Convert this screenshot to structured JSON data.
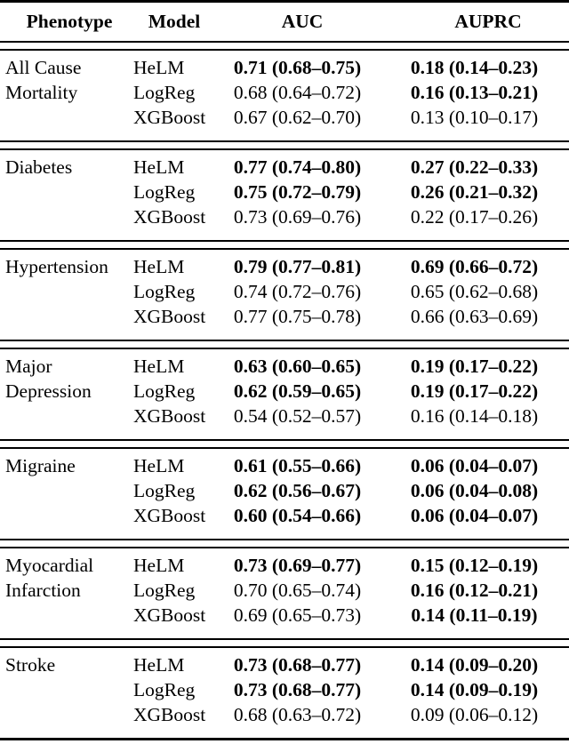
{
  "table": {
    "columns": [
      "Phenotype",
      "Model",
      "AUC",
      "AUPRC"
    ],
    "headers": {
      "phenotype": "Phenotype",
      "model": "Model",
      "auc": "AUC",
      "auprc": "AUPRC"
    },
    "blocks": [
      {
        "phenotype": "All Cause Mortality",
        "phenotype_line1": "All Cause",
        "phenotype_line2": "Mortality",
        "rows": [
          {
            "model": "HeLM",
            "auc": "0.71 (0.68–0.75)",
            "auc_bold": true,
            "auprc": "0.18 (0.14–0.23)",
            "auprc_bold": true
          },
          {
            "model": "LogReg",
            "auc": "0.68 (0.64–0.72)",
            "auc_bold": false,
            "auprc": "0.16 (0.13–0.21)",
            "auprc_bold": true
          },
          {
            "model": "XGBoost",
            "auc": "0.67 (0.62–0.70)",
            "auc_bold": false,
            "auprc": "0.13 (0.10–0.17)",
            "auprc_bold": false
          }
        ]
      },
      {
        "phenotype": "Diabetes",
        "phenotype_line1": "Diabetes",
        "phenotype_line2": "",
        "rows": [
          {
            "model": "HeLM",
            "auc": "0.77 (0.74–0.80)",
            "auc_bold": true,
            "auprc": "0.27 (0.22–0.33)",
            "auprc_bold": true
          },
          {
            "model": "LogReg",
            "auc": "0.75 (0.72–0.79)",
            "auc_bold": true,
            "auprc": "0.26 (0.21–0.32)",
            "auprc_bold": true
          },
          {
            "model": "XGBoost",
            "auc": "0.73 (0.69–0.76)",
            "auc_bold": false,
            "auprc": "0.22 (0.17–0.26)",
            "auprc_bold": false
          }
        ]
      },
      {
        "phenotype": "Hypertension",
        "phenotype_line1": "Hypertension",
        "phenotype_line2": "",
        "rows": [
          {
            "model": "HeLM",
            "auc": "0.79 (0.77–0.81)",
            "auc_bold": true,
            "auprc": "0.69 (0.66–0.72)",
            "auprc_bold": true
          },
          {
            "model": "LogReg",
            "auc": "0.74 (0.72–0.76)",
            "auc_bold": false,
            "auprc": "0.65 (0.62–0.68)",
            "auprc_bold": false
          },
          {
            "model": "XGBoost",
            "auc": "0.77 (0.75–0.78)",
            "auc_bold": false,
            "auprc": "0.66 (0.63–0.69)",
            "auprc_bold": false
          }
        ]
      },
      {
        "phenotype": "Major Depression",
        "phenotype_line1": "Major",
        "phenotype_line2": "Depression",
        "rows": [
          {
            "model": "HeLM",
            "auc": "0.63 (0.60–0.65)",
            "auc_bold": true,
            "auprc": "0.19 (0.17–0.22)",
            "auprc_bold": true
          },
          {
            "model": "LogReg",
            "auc": "0.62 (0.59–0.65)",
            "auc_bold": true,
            "auprc": "0.19 (0.17–0.22)",
            "auprc_bold": true
          },
          {
            "model": "XGBoost",
            "auc": "0.54 (0.52–0.57)",
            "auc_bold": false,
            "auprc": "0.16 (0.14–0.18)",
            "auprc_bold": false
          }
        ]
      },
      {
        "phenotype": "Migraine",
        "phenotype_line1": "Migraine",
        "phenotype_line2": "",
        "rows": [
          {
            "model": "HeLM",
            "auc": "0.61 (0.55–0.66)",
            "auc_bold": true,
            "auprc": "0.06 (0.04–0.07)",
            "auprc_bold": true
          },
          {
            "model": "LogReg",
            "auc": "0.62 (0.56–0.67)",
            "auc_bold": true,
            "auprc": "0.06 (0.04–0.08)",
            "auprc_bold": true
          },
          {
            "model": "XGBoost",
            "auc": "0.60 (0.54–0.66)",
            "auc_bold": true,
            "auprc": "0.06 (0.04–0.07)",
            "auprc_bold": true
          }
        ]
      },
      {
        "phenotype": "Myocardial Infarction",
        "phenotype_line1": "Myocardial",
        "phenotype_line2": "Infarction",
        "rows": [
          {
            "model": "HeLM",
            "auc": "0.73 (0.69–0.77)",
            "auc_bold": true,
            "auprc": "0.15 (0.12–0.19)",
            "auprc_bold": true
          },
          {
            "model": "LogReg",
            "auc": "0.70 (0.65–0.74)",
            "auc_bold": false,
            "auprc": "0.16 (0.12–0.21)",
            "auprc_bold": true
          },
          {
            "model": "XGBoost",
            "auc": "0.69 (0.65–0.73)",
            "auc_bold": false,
            "auprc": "0.14 (0.11–0.19)",
            "auprc_bold": true
          }
        ]
      },
      {
        "phenotype": "Stroke",
        "phenotype_line1": "Stroke",
        "phenotype_line2": "",
        "rows": [
          {
            "model": "HeLM",
            "auc": "0.73 (0.68–0.77)",
            "auc_bold": true,
            "auprc": "0.14 (0.09–0.20)",
            "auprc_bold": true
          },
          {
            "model": "LogReg",
            "auc": "0.73 (0.68–0.77)",
            "auc_bold": true,
            "auprc": "0.14 (0.09–0.19)",
            "auprc_bold": true
          },
          {
            "model": "XGBoost",
            "auc": "0.68 (0.63–0.72)",
            "auc_bold": false,
            "auprc": "0.09 (0.06–0.12)",
            "auprc_bold": false
          }
        ]
      }
    ]
  }
}
